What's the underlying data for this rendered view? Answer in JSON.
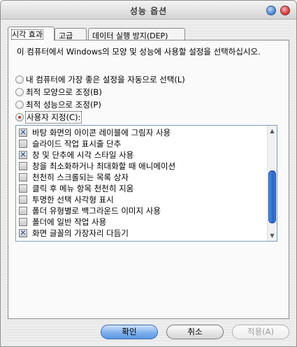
{
  "window": {
    "title": "성능 옵션"
  },
  "title_buttons": {
    "minimize": "●",
    "close": "●"
  },
  "tabs": [
    {
      "label": "시각 효과",
      "active": true
    },
    {
      "label": "고급",
      "active": false
    },
    {
      "label": "데이터 실행 방지(DEP)",
      "active": false
    }
  ],
  "description": "이 컴퓨터에서 Windows의 모양 및 성능에 사용할 설정을 선택하십시오.",
  "radios": [
    {
      "label": "내 컴퓨터에 가장 좋은 설정을 자동으로 선택(L)",
      "selected": false
    },
    {
      "label": "최적 모양으로 조정(B)",
      "selected": false
    },
    {
      "label": "최적 성능으로 조정(P)",
      "selected": false
    },
    {
      "label": "사용자 지정(C):",
      "selected": true
    }
  ],
  "options": [
    {
      "label": "바탕 화면의 아이콘 레이블에 그림자 사용",
      "checked": true
    },
    {
      "label": "슬라이드 작업 표시줄 단추",
      "checked": false
    },
    {
      "label": "창 및 단추에 시각 스타일 사용",
      "checked": true
    },
    {
      "label": "창을 최소화하거나 최대화할 때 애니메이션",
      "checked": false
    },
    {
      "label": "천천히 스크롤되는 목록 상자",
      "checked": false
    },
    {
      "label": "클릭 후 메뉴 항목 천천히 지움",
      "checked": false
    },
    {
      "label": "투명한 선택 사각형 표시",
      "checked": false
    },
    {
      "label": "폴더 유형별로 백그라운드 이미지 사용",
      "checked": false
    },
    {
      "label": "폴더에 일반 작업 사용",
      "checked": false
    },
    {
      "label": "화면 글꼴의 가장자리 다듬기",
      "checked": true
    }
  ],
  "check_glyph": "✕",
  "scrollbar": {
    "up": "▲",
    "down": "▼"
  },
  "buttons": {
    "ok": "확인",
    "cancel": "취소",
    "apply": "적용(A)"
  },
  "colors": {
    "thumb": "#2a65c6",
    "ok_button": "#7fb0ec",
    "radio_dot": "#c43a2a"
  }
}
